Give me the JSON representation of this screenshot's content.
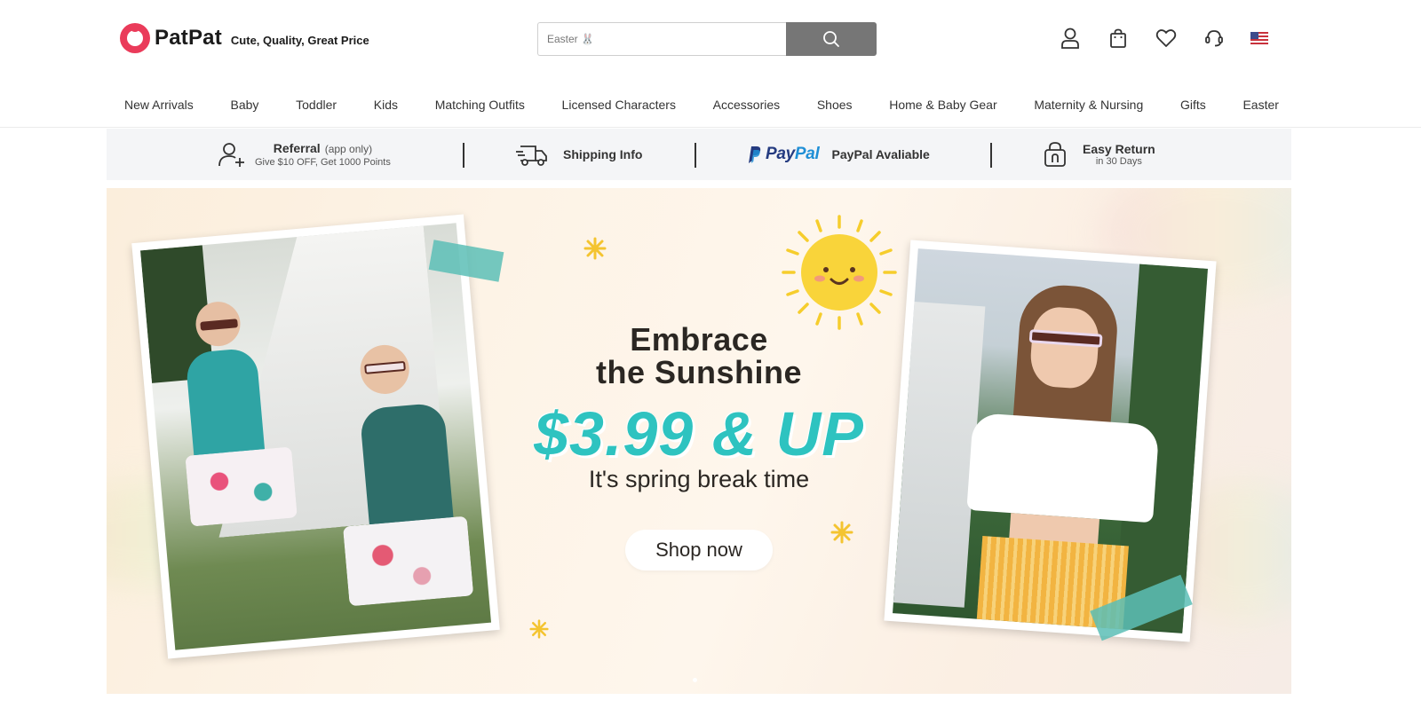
{
  "brand": {
    "name": "PatPat",
    "tagline": "Cute, Quality, Great Price",
    "accent_color": "#ea3b5a"
  },
  "search": {
    "placeholder": "Easter 🐰",
    "button_icon": "search-icon"
  },
  "header_icons": [
    {
      "name": "account-icon"
    },
    {
      "name": "cart-icon"
    },
    {
      "name": "wishlist-icon"
    },
    {
      "name": "support-icon"
    },
    {
      "name": "us-flag-icon"
    }
  ],
  "nav": {
    "items": [
      "New Arrivals",
      "Baby",
      "Toddler",
      "Kids",
      "Matching Outfits",
      "Licensed Characters",
      "Accessories",
      "Shoes",
      "Home & Baby Gear",
      "Maternity & Nursing",
      "Gifts",
      "Easter"
    ]
  },
  "infobar": {
    "referral": {
      "title": "Referral",
      "note": "(app only)",
      "sub": "Give $10 OFF, Get 1000 Points",
      "icon": "add-user-icon"
    },
    "shipping": {
      "title": "Shipping Info",
      "icon": "truck-icon"
    },
    "paypal": {
      "logo_a": "Pay",
      "logo_b": "Pal",
      "title": "PayPal Avaliable",
      "icon": "paypal-icon"
    },
    "returns": {
      "title": "Easy Return",
      "sub": "in 30 Days",
      "icon": "shopping-bag-icon"
    }
  },
  "banner": {
    "headline_1": "Embrace",
    "headline_2": "the Sunshine",
    "price": "$3.99 & UP",
    "subline": "It's spring break time",
    "cta": "Shop now",
    "price_color": "#2ec3c0",
    "background_color": "#fdf3e6"
  }
}
